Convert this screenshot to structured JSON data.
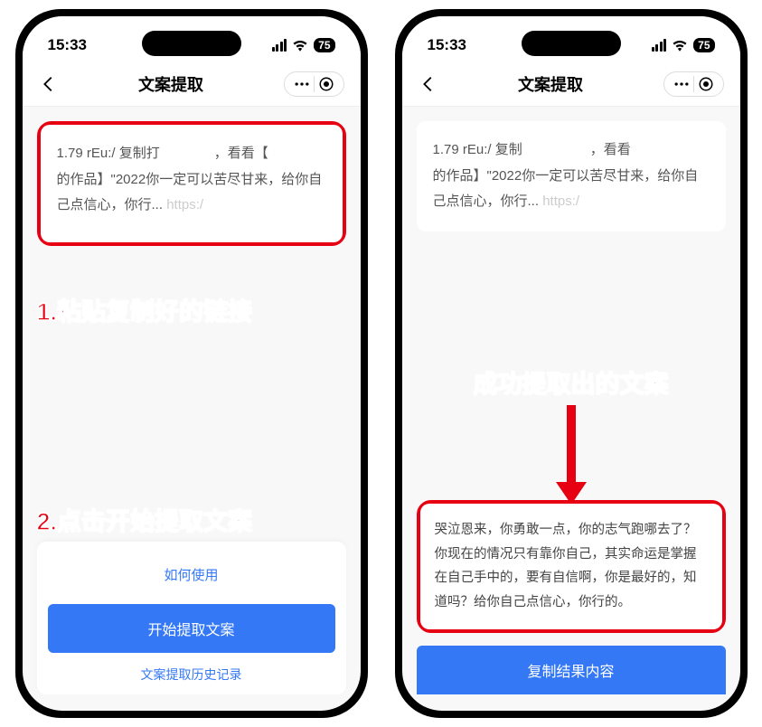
{
  "status": {
    "time": "15:33",
    "battery": "75"
  },
  "nav": {
    "title": "文案提取"
  },
  "phone1": {
    "input_text": "1.79 rEu:/ 复制打　　　　，看看【　　　　的作品】\"2022你一定可以苦尽甘来，给你自己点信心，你行...",
    "input_url": "https:/",
    "how_to": "如何使用",
    "start_btn": "开始提取文案",
    "history": "文案提取历史记录"
  },
  "phone2": {
    "input_text": "1.79 rEu:/ 复制　　　　　，看看　　　　　的作品】\"2022你一定可以苦尽甘来，给你自己点信心，你行...",
    "input_url": "https:/",
    "result": "哭泣恩来，你勇敢一点，你的志气跑哪去了？你现在的情况只有靠你自己，其实命运是掌握在自己手中的，要有自信啊，你是最好的，知道吗？给你自己点信心，你行的。",
    "copy_btn": "复制结果内容"
  },
  "ann": {
    "step1": "1.粘贴复制好的链接",
    "step2": "2.点击开始提取文案",
    "result_title": "成功提取出的文案"
  }
}
